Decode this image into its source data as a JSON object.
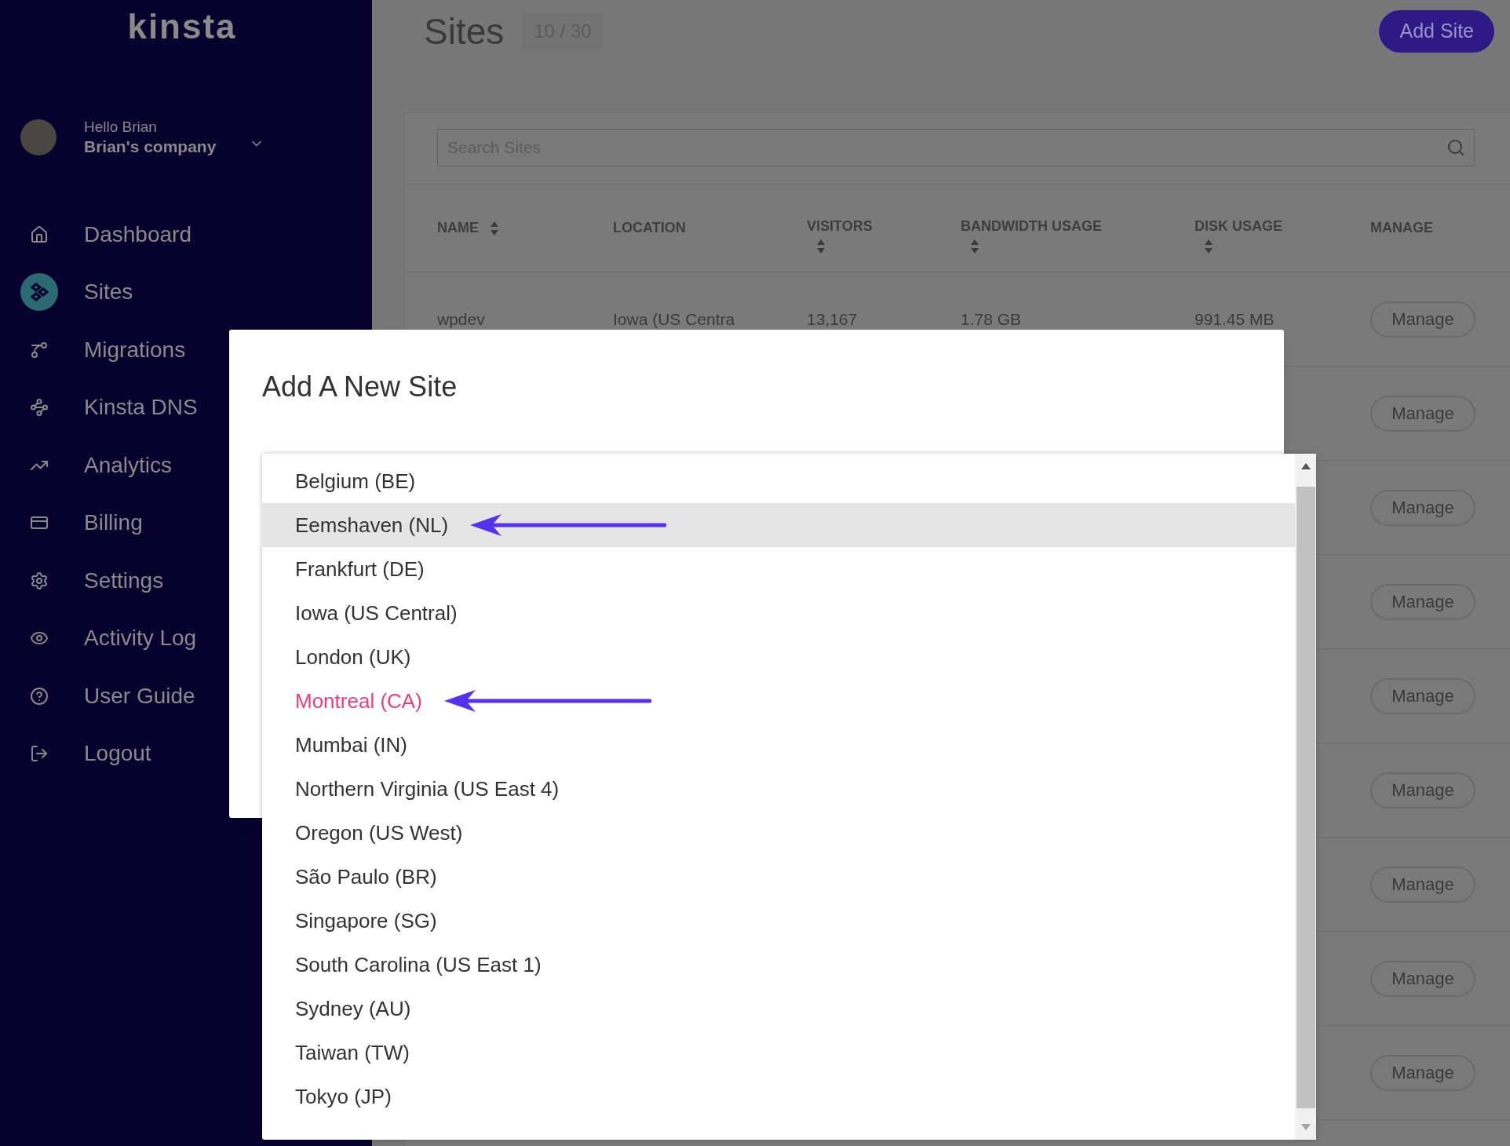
{
  "sidebar": {
    "logo": "kinsta",
    "greeting": "Hello Brian",
    "company": "Brian's company",
    "items": [
      {
        "label": "Dashboard",
        "selected": false
      },
      {
        "label": "Sites",
        "selected": true
      },
      {
        "label": "Migrations",
        "selected": false
      },
      {
        "label": "Kinsta DNS",
        "selected": false
      },
      {
        "label": "Analytics",
        "selected": false
      },
      {
        "label": "Billing",
        "selected": false
      },
      {
        "label": "Settings",
        "selected": false
      },
      {
        "label": "Activity Log",
        "selected": false
      },
      {
        "label": "User Guide",
        "selected": false
      },
      {
        "label": "Logout",
        "selected": false
      }
    ]
  },
  "header": {
    "title": "Sites",
    "count": "10 / 30",
    "add_button": "Add Site"
  },
  "search": {
    "placeholder": "Search Sites"
  },
  "table": {
    "columns": [
      {
        "label": "NAME",
        "sortable": true
      },
      {
        "label": "LOCATION",
        "sortable": false
      },
      {
        "label": "VISITORS",
        "sortable": true
      },
      {
        "label": "BANDWIDTH USAGE",
        "sortable": true
      },
      {
        "label": "DISK USAGE",
        "sortable": true
      },
      {
        "label": "MANAGE",
        "sortable": false
      }
    ],
    "rows": [
      {
        "cells": [
          "wpdev",
          "Iowa (US Centra",
          "13,167",
          "1.78 GB",
          "991.45 MB"
        ],
        "manage": "Manage"
      },
      {
        "cells": [],
        "manage": "Manage"
      },
      {
        "cells": [],
        "manage": "Manage"
      },
      {
        "cells": [],
        "manage": "Manage"
      },
      {
        "cells": [],
        "manage": "Manage"
      },
      {
        "cells": [],
        "manage": "Manage"
      },
      {
        "cells": [],
        "manage": "Manage"
      },
      {
        "cells": [],
        "manage": "Manage"
      },
      {
        "cells": [],
        "manage": "Manage"
      }
    ]
  },
  "dialog": {
    "title": "Add A New Site",
    "options": [
      {
        "label": "Belgium (BE)",
        "highlighted": false,
        "selected": false,
        "annotated": false
      },
      {
        "label": "Eemshaven (NL)",
        "highlighted": true,
        "selected": false,
        "annotated": true
      },
      {
        "label": "Frankfurt (DE)",
        "highlighted": false,
        "selected": false,
        "annotated": false
      },
      {
        "label": "Iowa (US Central)",
        "highlighted": false,
        "selected": false,
        "annotated": false
      },
      {
        "label": "London (UK)",
        "highlighted": false,
        "selected": false,
        "annotated": false
      },
      {
        "label": "Montreal (CA)",
        "highlighted": false,
        "selected": true,
        "annotated": true
      },
      {
        "label": "Mumbai (IN)",
        "highlighted": false,
        "selected": false,
        "annotated": false
      },
      {
        "label": "Northern Virginia (US East 4)",
        "highlighted": false,
        "selected": false,
        "annotated": false
      },
      {
        "label": "Oregon (US West)",
        "highlighted": false,
        "selected": false,
        "annotated": false
      },
      {
        "label": "São Paulo (BR)",
        "highlighted": false,
        "selected": false,
        "annotated": false
      },
      {
        "label": "Singapore (SG)",
        "highlighted": false,
        "selected": false,
        "annotated": false
      },
      {
        "label": "South Carolina (US East 1)",
        "highlighted": false,
        "selected": false,
        "annotated": false
      },
      {
        "label": "Sydney (AU)",
        "highlighted": false,
        "selected": false,
        "annotated": false
      },
      {
        "label": "Taiwan (TW)",
        "highlighted": false,
        "selected": false,
        "annotated": false
      },
      {
        "label": "Tokyo (JP)",
        "highlighted": false,
        "selected": false,
        "annotated": false
      }
    ]
  }
}
